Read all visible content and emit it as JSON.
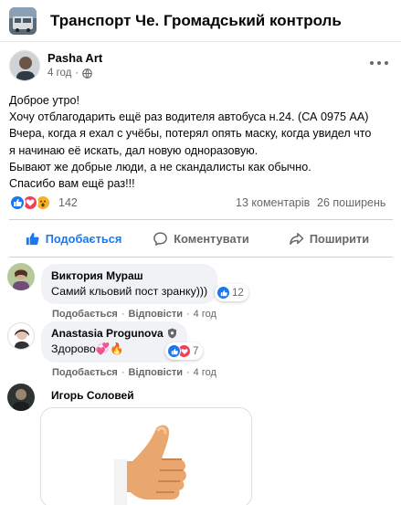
{
  "group": {
    "title": "Транспорт Че. Громадський контроль",
    "thumbnail_icon": "bus-icon"
  },
  "post": {
    "author": "Pasha Art",
    "time": "4 год",
    "visibility_icon": "globe-icon",
    "lines": [
      "Доброе утро!",
      "Хочу отблагодарить ещё раз водителя автобуса н.24. (СА 0975 АА)",
      "Вчера, когда я ехал с учёбы, потерял опять маску, когда увидел что",
      "я начинаю её искать, дал новую одноразовую.",
      "Бывают же добрые люди, а не скандалисты как обычно.",
      "Спасибо вам ещё раз!!!"
    ],
    "reactions": {
      "icons": [
        "like-icon",
        "love-icon",
        "wow-icon"
      ],
      "count": "142"
    },
    "comments_count": "13 коментарів",
    "shares_count": "26 поширень"
  },
  "actions": {
    "like": "Подобається",
    "comment": "Коментувати",
    "share": "Поширити"
  },
  "comments": [
    {
      "author": "Виктория Мураш",
      "text": "Самий кльовий пост зранку)))",
      "reaction_count": "12",
      "reaction_icons": [
        "like-icon"
      ],
      "actions": {
        "like": "Подобається",
        "reply": "Відповісти",
        "time": "4 год"
      }
    },
    {
      "author": "Anastasia Progunova",
      "badge_icon": "shield-icon",
      "text": "Здорово💞🔥",
      "reaction_count": "7",
      "reaction_icons": [
        "like-icon",
        "love-icon"
      ],
      "actions": {
        "like": "Подобається",
        "reply": "Відповісти",
        "time": "4 год"
      }
    },
    {
      "author": "Игорь Соловей",
      "attachment_icon": "thumbs-up-photo"
    }
  ],
  "colors": {
    "accent": "#1877f2",
    "muted": "#65676b",
    "bubble": "#f0f2f5",
    "love": "#f33e58",
    "wow": "#f7b125"
  }
}
